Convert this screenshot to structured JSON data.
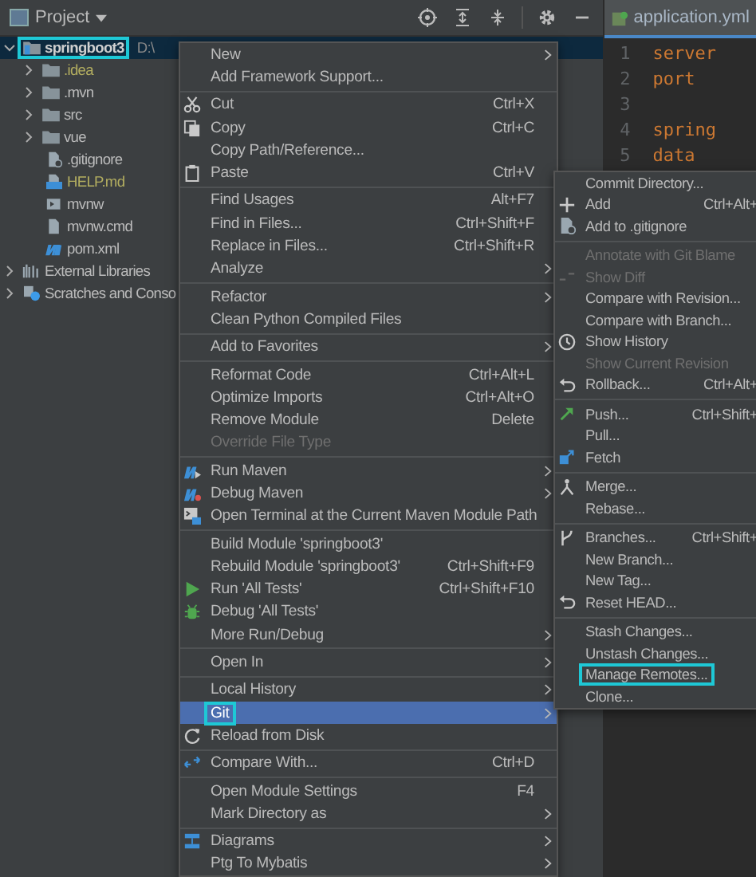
{
  "project_panel": {
    "title": "Project",
    "tree": [
      {
        "label": "springboot3",
        "path": "D:\\",
        "kind": "module",
        "expanded": true,
        "selected": true,
        "outlined": true,
        "ignored": false,
        "children": [
          {
            "label": ".idea",
            "kind": "folder",
            "expanded": false,
            "selected": false,
            "outlined": false,
            "ignored": true
          },
          {
            "label": ".mvn",
            "kind": "folder",
            "expanded": false,
            "selected": false,
            "outlined": false,
            "ignored": false
          },
          {
            "label": "src",
            "kind": "folder",
            "expanded": false,
            "selected": false,
            "outlined": false,
            "ignored": false
          },
          {
            "label": "vue",
            "kind": "folder",
            "expanded": false,
            "selected": false,
            "outlined": false,
            "ignored": false
          },
          {
            "label": ".gitignore",
            "kind": "gitignore",
            "selected": false,
            "outlined": false,
            "ignored": false
          },
          {
            "label": "HELP.md",
            "kind": "markdown",
            "selected": false,
            "outlined": false,
            "ignored": true
          },
          {
            "label": "mvnw",
            "kind": "script",
            "selected": false,
            "outlined": false,
            "ignored": false
          },
          {
            "label": "mvnw.cmd",
            "kind": "file",
            "selected": false,
            "outlined": false,
            "ignored": false
          },
          {
            "label": "pom.xml",
            "kind": "maven",
            "selected": false,
            "outlined": false,
            "ignored": false
          }
        ]
      },
      {
        "label": "External Libraries",
        "kind": "library",
        "expanded": false,
        "selected": false,
        "outlined": false,
        "ignored": false
      },
      {
        "label": "Scratches and Conso",
        "kind": "scratches",
        "expanded": false,
        "selected": false,
        "outlined": false,
        "ignored": false
      }
    ]
  },
  "editor": {
    "tab": "application.yml",
    "lines": [
      {
        "number": "1",
        "code": "server"
      },
      {
        "number": "2",
        "code": "port"
      },
      {
        "number": "3"
      },
      {
        "number": "4",
        "code": "spring"
      },
      {
        "number": "5",
        "code": "data"
      }
    ]
  },
  "context_menu": [
    {
      "kind": "item",
      "label": "New",
      "disabled": false,
      "submenu": true,
      "selected": false,
      "outlined": false
    },
    {
      "kind": "item",
      "label": "Add Framework Support...",
      "disabled": false,
      "submenu": false,
      "selected": false,
      "outlined": false
    },
    {
      "kind": "separator"
    },
    {
      "kind": "item",
      "label": "Cut",
      "shortcut": "Ctrl+X",
      "disabled": false,
      "submenu": false,
      "selected": false,
      "outlined": false
    },
    {
      "kind": "item",
      "label": "Copy",
      "shortcut": "Ctrl+C",
      "disabled": false,
      "submenu": false,
      "selected": false,
      "outlined": false
    },
    {
      "kind": "item",
      "label": "Copy Path/Reference...",
      "disabled": false,
      "submenu": false,
      "selected": false,
      "outlined": false
    },
    {
      "kind": "item",
      "label": "Paste",
      "shortcut": "Ctrl+V",
      "disabled": false,
      "submenu": false,
      "selected": false,
      "outlined": false
    },
    {
      "kind": "separator"
    },
    {
      "kind": "item",
      "label": "Find Usages",
      "shortcut": "Alt+F7",
      "disabled": false,
      "submenu": false,
      "selected": false,
      "outlined": false
    },
    {
      "kind": "item",
      "label": "Find in Files...",
      "shortcut": "Ctrl+Shift+F",
      "disabled": false,
      "submenu": false,
      "selected": false,
      "outlined": false
    },
    {
      "kind": "item",
      "label": "Replace in Files...",
      "shortcut": "Ctrl+Shift+R",
      "disabled": false,
      "submenu": false,
      "selected": false,
      "outlined": false
    },
    {
      "kind": "item",
      "label": "Analyze",
      "disabled": false,
      "submenu": true,
      "selected": false,
      "outlined": false
    },
    {
      "kind": "separator"
    },
    {
      "kind": "item",
      "label": "Refactor",
      "disabled": false,
      "submenu": true,
      "selected": false,
      "outlined": false
    },
    {
      "kind": "item",
      "label": "Clean Python Compiled Files",
      "disabled": false,
      "submenu": false,
      "selected": false,
      "outlined": false
    },
    {
      "kind": "separator"
    },
    {
      "kind": "item",
      "label": "Add to Favorites",
      "disabled": false,
      "submenu": true,
      "selected": false,
      "outlined": false
    },
    {
      "kind": "separator"
    },
    {
      "kind": "item",
      "label": "Reformat Code",
      "shortcut": "Ctrl+Alt+L",
      "disabled": false,
      "submenu": false,
      "selected": false,
      "outlined": false
    },
    {
      "kind": "item",
      "label": "Optimize Imports",
      "shortcut": "Ctrl+Alt+O",
      "disabled": false,
      "submenu": false,
      "selected": false,
      "outlined": false
    },
    {
      "kind": "item",
      "label": "Remove Module",
      "shortcut": "Delete",
      "disabled": false,
      "submenu": false,
      "selected": false,
      "outlined": false
    },
    {
      "kind": "item",
      "label": "Override File Type",
      "disabled": true,
      "submenu": false,
      "selected": false,
      "outlined": false
    },
    {
      "kind": "separator"
    },
    {
      "kind": "item",
      "label": "Run Maven",
      "disabled": false,
      "submenu": true,
      "selected": false,
      "outlined": false
    },
    {
      "kind": "item",
      "label": "Debug Maven",
      "disabled": false,
      "submenu": true,
      "selected": false,
      "outlined": false
    },
    {
      "kind": "item",
      "label": "Open Terminal at the Current Maven Module Path",
      "disabled": false,
      "submenu": false,
      "selected": false,
      "outlined": false
    },
    {
      "kind": "separator"
    },
    {
      "kind": "item",
      "label": "Build Module 'springboot3'",
      "disabled": false,
      "submenu": false,
      "selected": false,
      "outlined": false
    },
    {
      "kind": "item",
      "label": "Rebuild Module 'springboot3'",
      "shortcut": "Ctrl+Shift+F9",
      "disabled": false,
      "submenu": false,
      "selected": false,
      "outlined": false
    },
    {
      "kind": "item",
      "label": "Run 'All Tests'",
      "shortcut": "Ctrl+Shift+F10",
      "disabled": false,
      "submenu": false,
      "selected": false,
      "outlined": false
    },
    {
      "kind": "item",
      "label": "Debug 'All Tests'",
      "disabled": false,
      "submenu": false,
      "selected": false,
      "outlined": false
    },
    {
      "kind": "item",
      "label": "More Run/Debug",
      "disabled": false,
      "submenu": true,
      "selected": false,
      "outlined": false
    },
    {
      "kind": "separator"
    },
    {
      "kind": "item",
      "label": "Open In",
      "disabled": false,
      "submenu": true,
      "selected": false,
      "outlined": false
    },
    {
      "kind": "separator"
    },
    {
      "kind": "item",
      "label": "Local History",
      "disabled": false,
      "submenu": true,
      "selected": false,
      "outlined": false
    },
    {
      "kind": "item",
      "label": "Git",
      "disabled": false,
      "submenu": true,
      "selected": true,
      "outlined": true
    },
    {
      "kind": "item",
      "label": "Reload from Disk",
      "disabled": false,
      "submenu": false,
      "selected": false,
      "outlined": false
    },
    {
      "kind": "separator"
    },
    {
      "kind": "item",
      "label": "Compare With...",
      "shortcut": "Ctrl+D",
      "disabled": false,
      "submenu": false,
      "selected": false,
      "outlined": false
    },
    {
      "kind": "separator"
    },
    {
      "kind": "item",
      "label": "Open Module Settings",
      "shortcut": "F4",
      "disabled": false,
      "submenu": false,
      "selected": false,
      "outlined": false
    },
    {
      "kind": "item",
      "label": "Mark Directory as",
      "disabled": false,
      "submenu": true,
      "selected": false,
      "outlined": false
    },
    {
      "kind": "separator"
    },
    {
      "kind": "item",
      "label": "Diagrams",
      "disabled": false,
      "submenu": true,
      "selected": false,
      "outlined": false
    },
    {
      "kind": "item",
      "label": "Ptg To Mybatis",
      "disabled": false,
      "submenu": true,
      "selected": false,
      "outlined": false
    }
  ],
  "git_submenu": [
    {
      "kind": "item",
      "label": "Commit Directory...",
      "disabled": false,
      "selected": false,
      "outlined": false
    },
    {
      "kind": "item",
      "label": "Add",
      "shortcut": "Ctrl+Alt+",
      "disabled": false,
      "selected": false,
      "outlined": false
    },
    {
      "kind": "item",
      "label": "Add to .gitignore",
      "disabled": false,
      "selected": false,
      "outlined": false
    },
    {
      "kind": "separator"
    },
    {
      "kind": "item",
      "label": "Annotate with Git Blame",
      "disabled": true,
      "selected": false,
      "outlined": false
    },
    {
      "kind": "item",
      "label": "Show Diff",
      "disabled": true,
      "selected": false,
      "outlined": false
    },
    {
      "kind": "item",
      "label": "Compare with Revision...",
      "disabled": false,
      "selected": false,
      "outlined": false
    },
    {
      "kind": "item",
      "label": "Compare with Branch...",
      "disabled": false,
      "selected": false,
      "outlined": false
    },
    {
      "kind": "item",
      "label": "Show History",
      "disabled": false,
      "selected": false,
      "outlined": false
    },
    {
      "kind": "item",
      "label": "Show Current Revision",
      "disabled": true,
      "selected": false,
      "outlined": false
    },
    {
      "kind": "item",
      "label": "Rollback...",
      "shortcut": "Ctrl+Alt+",
      "disabled": false,
      "selected": false,
      "outlined": false
    },
    {
      "kind": "separator"
    },
    {
      "kind": "item",
      "label": "Push...",
      "shortcut": "Ctrl+Shift+",
      "disabled": false,
      "selected": false,
      "outlined": false
    },
    {
      "kind": "item",
      "label": "Pull...",
      "disabled": false,
      "selected": false,
      "outlined": false
    },
    {
      "kind": "item",
      "label": "Fetch",
      "disabled": false,
      "selected": false,
      "outlined": false
    },
    {
      "kind": "separator"
    },
    {
      "kind": "item",
      "label": "Merge...",
      "disabled": false,
      "selected": false,
      "outlined": false
    },
    {
      "kind": "item",
      "label": "Rebase...",
      "disabled": false,
      "selected": false,
      "outlined": false
    },
    {
      "kind": "separator"
    },
    {
      "kind": "item",
      "label": "Branches...",
      "shortcut": "Ctrl+Shift+",
      "disabled": false,
      "selected": false,
      "outlined": false
    },
    {
      "kind": "item",
      "label": "New Branch...",
      "disabled": false,
      "selected": false,
      "outlined": false
    },
    {
      "kind": "item",
      "label": "New Tag...",
      "disabled": false,
      "selected": false,
      "outlined": false
    },
    {
      "kind": "item",
      "label": "Reset HEAD...",
      "disabled": false,
      "selected": false,
      "outlined": false
    },
    {
      "kind": "separator"
    },
    {
      "kind": "item",
      "label": "Stash Changes...",
      "disabled": false,
      "selected": false,
      "outlined": false
    },
    {
      "kind": "item",
      "label": "Unstash Changes...",
      "disabled": false,
      "selected": false,
      "outlined": false
    },
    {
      "kind": "item",
      "label": "Manage Remotes...",
      "disabled": false,
      "selected": false,
      "outlined": true
    },
    {
      "kind": "item",
      "label": "Clone...",
      "disabled": false,
      "selected": false,
      "outlined": false
    }
  ]
}
